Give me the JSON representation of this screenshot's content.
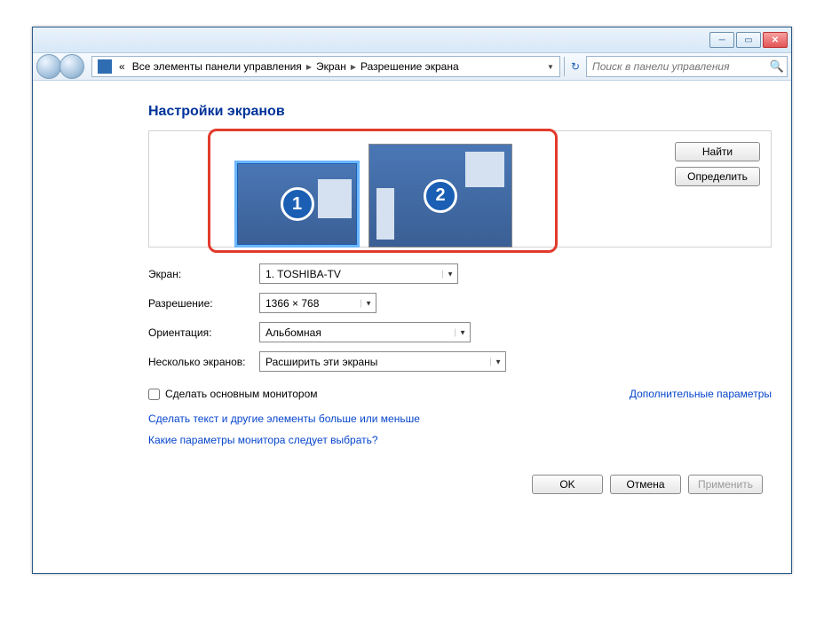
{
  "breadcrumb": {
    "root": "«",
    "items": [
      "Все элементы панели управления",
      "Экран",
      "Разрешение экрана"
    ]
  },
  "search": {
    "placeholder": "Поиск в панели управления"
  },
  "heading": "Настройки экранов",
  "monitors": [
    {
      "number": "1",
      "selected": true
    },
    {
      "number": "2",
      "selected": false
    }
  ],
  "buttons": {
    "detect": "Найти",
    "identify": "Определить",
    "ok": "OK",
    "cancel": "Отмена",
    "apply": "Применить"
  },
  "form": {
    "display": {
      "label": "Экран:",
      "value": "1. TOSHIBA-TV"
    },
    "resolution": {
      "label": "Разрешение:",
      "value": "1366 × 768"
    },
    "orientation": {
      "label": "Ориентация:",
      "value": "Альбомная"
    },
    "multi": {
      "label": "Несколько экранов:",
      "value": "Расширить эти экраны"
    },
    "makeMain": "Сделать основным монитором"
  },
  "links": {
    "advanced": "Дополнительные параметры",
    "textSize": "Сделать текст и другие элементы больше или меньше",
    "whichSettings": "Какие параметры монитора следует выбрать?"
  }
}
